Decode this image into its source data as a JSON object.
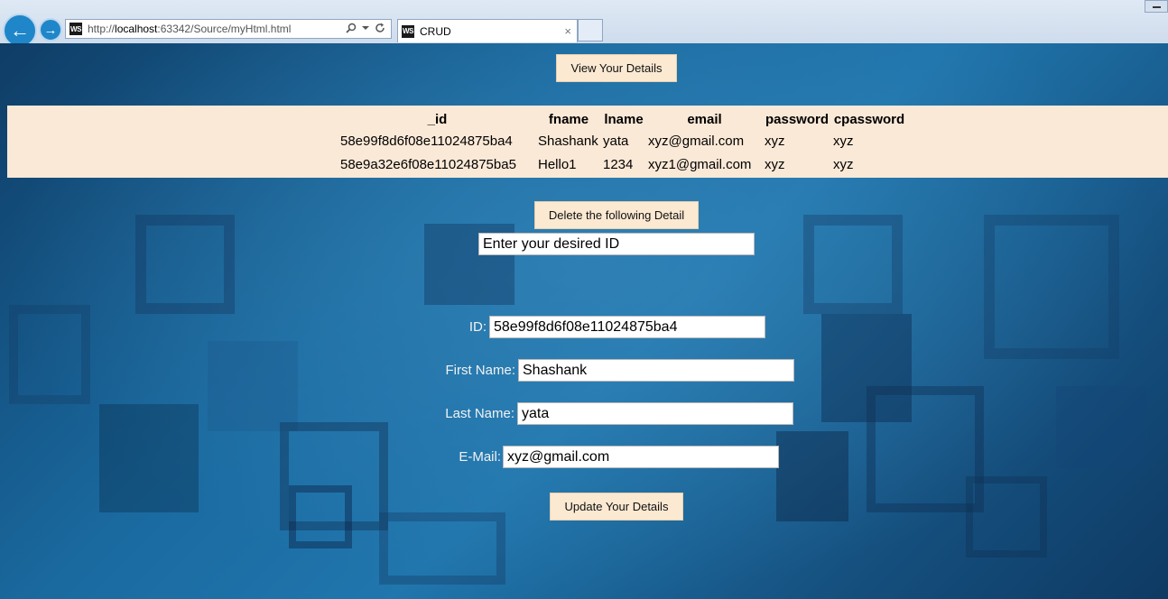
{
  "browser": {
    "url_prefix": "http://",
    "url_host": "localhost",
    "url_rest": ":63342/Source/myHtml.html",
    "tab_title": "CRUD",
    "tab_close_glyph": "×",
    "back_glyph": "←",
    "forward_glyph": "→",
    "favicon_text": "WS"
  },
  "view_button_label": "View Your Details",
  "table": {
    "headers": [
      "_id",
      "fname",
      "lname",
      "email",
      "password",
      "cpassword"
    ],
    "rows": [
      [
        "58e99f8d6f08e11024875ba4",
        "Shashank",
        "yata",
        "xyz@gmail.com",
        "xyz",
        "xyz"
      ],
      [
        "58e9a32e6f08e11024875ba5",
        "Hello1",
        "1234",
        "xyz1@gmail.com",
        "xyz",
        "xyz"
      ]
    ]
  },
  "delete": {
    "button_label": "Delete the following Detail",
    "input_placeholder": "Enter your desired ID"
  },
  "form": {
    "id_label": "ID:",
    "id_value": "58e99f8d6f08e11024875ba4",
    "first_name_label": "First Name:",
    "first_name_value": "Shashank",
    "last_name_label": "Last Name:",
    "last_name_value": "yata",
    "email_label": "E-Mail:",
    "email_value": "xyz@gmail.com",
    "update_button_label": "Update Your Details"
  },
  "icons": {
    "search": "search-icon",
    "dropdown": "chevron-down-icon",
    "refresh": "refresh-icon",
    "close": "close-icon"
  },
  "colors": {
    "button_bg": "#fbe9d2",
    "table_bg": "#fbe9d7",
    "chrome_accent": "#1f86c9"
  }
}
